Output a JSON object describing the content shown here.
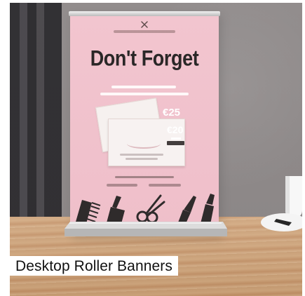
{
  "banner": {
    "headline": "Don't Forget",
    "price_primary": "€25",
    "price_secondary": "€20"
  },
  "caption": {
    "label": "Desktop Roller Banners"
  },
  "colors": {
    "banner_pink": "#efbfca",
    "headline_dark": "#2a2727",
    "caption_background": "#ffffff",
    "caption_text": "#111111"
  },
  "icons": {
    "logo": "scissors-icon",
    "tool_comb": "comb-icon",
    "tool_scissors": "scissors-icon",
    "tool_razor": "razor-icon",
    "tool_brush": "brush-icon"
  }
}
